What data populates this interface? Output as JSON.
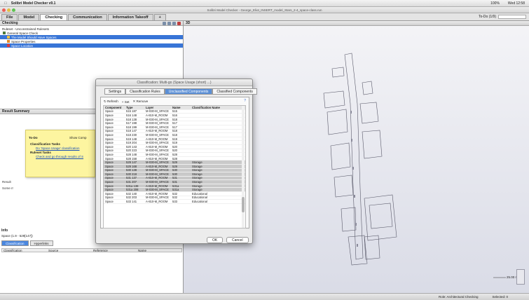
{
  "menubar": {
    "app_name": "Solibri Model Checker v9.1",
    "status_items": [
      "100%",
      "Wed 12:58"
    ]
  },
  "window": {
    "title": "Solibri Model Checker - George_Eliot_INSERT_model_Stars_2-4_space-class.run"
  },
  "tabs": [
    {
      "label": "File",
      "active": false
    },
    {
      "label": "Model",
      "active": false
    },
    {
      "label": "Checking",
      "active": true
    },
    {
      "label": "Communication",
      "active": false
    },
    {
      "label": "Information Takeoff",
      "active": false
    },
    {
      "label": "+",
      "active": false
    }
  ],
  "tabs_right": {
    "label": "To-Do (1/9)"
  },
  "left_panel": {
    "checking_title": "Checking",
    "ruleset_label": "Ruleset - Unconstrained Rulesets",
    "tree": [
      {
        "label": "General Space Check",
        "selected": false
      },
      {
        "label": "The Model Should Have Spaces",
        "selected": true
      },
      {
        "label": "Space Properties",
        "selected": false
      },
      {
        "label": "Space Location",
        "selected": true
      }
    ],
    "result_summary": "Result Summary",
    "result_label": "Result",
    "some_label": "Some rr",
    "info": {
      "title": "Info",
      "subtitle": "Space (1.9 - 529[147])",
      "tabs": [
        "Classification",
        "Hyperlinks"
      ],
      "columns": [
        "Classification",
        "Source",
        "Reference",
        "Name"
      ]
    }
  },
  "todo": {
    "title": "To-Do",
    "show_comp": "Show Comp",
    "tasks": [
      {
        "text": "Classification Tasks",
        "kind": "header"
      },
      {
        "text": "Do 'Space Usage' classification",
        "kind": "link"
      },
      {
        "text": "Ruleset Tasks",
        "kind": "header"
      },
      {
        "text": "Check and go through results of S",
        "kind": "link"
      }
    ]
  },
  "view": {
    "title": "3D",
    "scale": "25.00 m"
  },
  "dialog": {
    "title": "Classification: Multi-go (Space Usage (short) ...)",
    "tabs": [
      {
        "label": "Settings",
        "active": false
      },
      {
        "label": "Classification Rules",
        "active": false
      },
      {
        "label": "Unclassified Components",
        "active": true
      },
      {
        "label": "Classified Components",
        "active": false
      }
    ],
    "toolbar": [
      "Refresh",
      "Set",
      "Remove"
    ],
    "table": {
      "columns": [
        "Component",
        "Type",
        "Layer",
        "Name",
        "Classification Name"
      ],
      "rows": [
        [
          "Space",
          "515 187",
          "M-030-M_SPACE",
          "515",
          ""
        ],
        [
          "Space",
          "516 148",
          "A-810-M_ROOM",
          "516",
          ""
        ],
        [
          "Space",
          "518 138",
          "M-030-M_SPACE",
          "518",
          ""
        ],
        [
          "Space",
          "517 198",
          "M-030-M_SPACE",
          "517",
          ""
        ],
        [
          "Space",
          "518 199",
          "M-030-M_SPACE",
          "517",
          ""
        ],
        [
          "Space",
          "518 147",
          "A-810-M_ROOM",
          "518",
          ""
        ],
        [
          "Space",
          "518 230",
          "M-030-M_SPACE",
          "518",
          ""
        ],
        [
          "Space",
          "519 148",
          "A-810-M_ROOM",
          "519",
          ""
        ],
        [
          "Space",
          "519 204",
          "M-030-M_SPACE",
          "519",
          ""
        ],
        [
          "Space",
          "520 143",
          "A-810-M_ROOM",
          "520",
          ""
        ],
        [
          "Space",
          "520 223",
          "M-030-M_SPACE",
          "520",
          ""
        ],
        [
          "Space",
          "528 148",
          "M-030-M_SPACE",
          "528",
          ""
        ],
        [
          "Space",
          "528 158",
          "A-810-M_ROOM",
          "528",
          ""
        ],
        [
          "Space",
          "529 147",
          "M-030-M_SPACE",
          "529",
          "Storage"
        ],
        [
          "Space",
          "529 168",
          "A-810-M_ROOM",
          "529",
          "Storage"
        ],
        [
          "Space",
          "530 138",
          "M-030-M_SPACE",
          "530",
          "Storage"
        ],
        [
          "Space",
          "530 218",
          "M-030-M_SPACE",
          "530",
          "Storage"
        ],
        [
          "Space",
          "531 137",
          "A-810-M_ROOM",
          "531",
          "Storage"
        ],
        [
          "Space",
          "531 207",
          "M-030-M_SPACE",
          "531",
          "Storage"
        ],
        [
          "Space",
          "531a 138",
          "A-810-M_ROOM",
          "531a",
          "Storage"
        ],
        [
          "Space",
          "531a 208",
          "M-030-M_SPACE",
          "531a",
          "Storage"
        ],
        [
          "Space",
          "532 140",
          "A-810-M_ROOM",
          "532",
          "Educational"
        ],
        [
          "Space",
          "532 203",
          "M-030-M_SPACE",
          "532",
          "Educational"
        ],
        [
          "Space",
          "533 141",
          "A-810-M_ROOM",
          "533",
          "Educational"
        ]
      ],
      "selected_rows": [
        13,
        14,
        15,
        16,
        17,
        18,
        19,
        20
      ]
    },
    "ok": "OK",
    "cancel": "Cancel"
  },
  "statusbar": {
    "left": "",
    "mode": "Role: Architectural Checking",
    "selected": "Selected: 0"
  }
}
